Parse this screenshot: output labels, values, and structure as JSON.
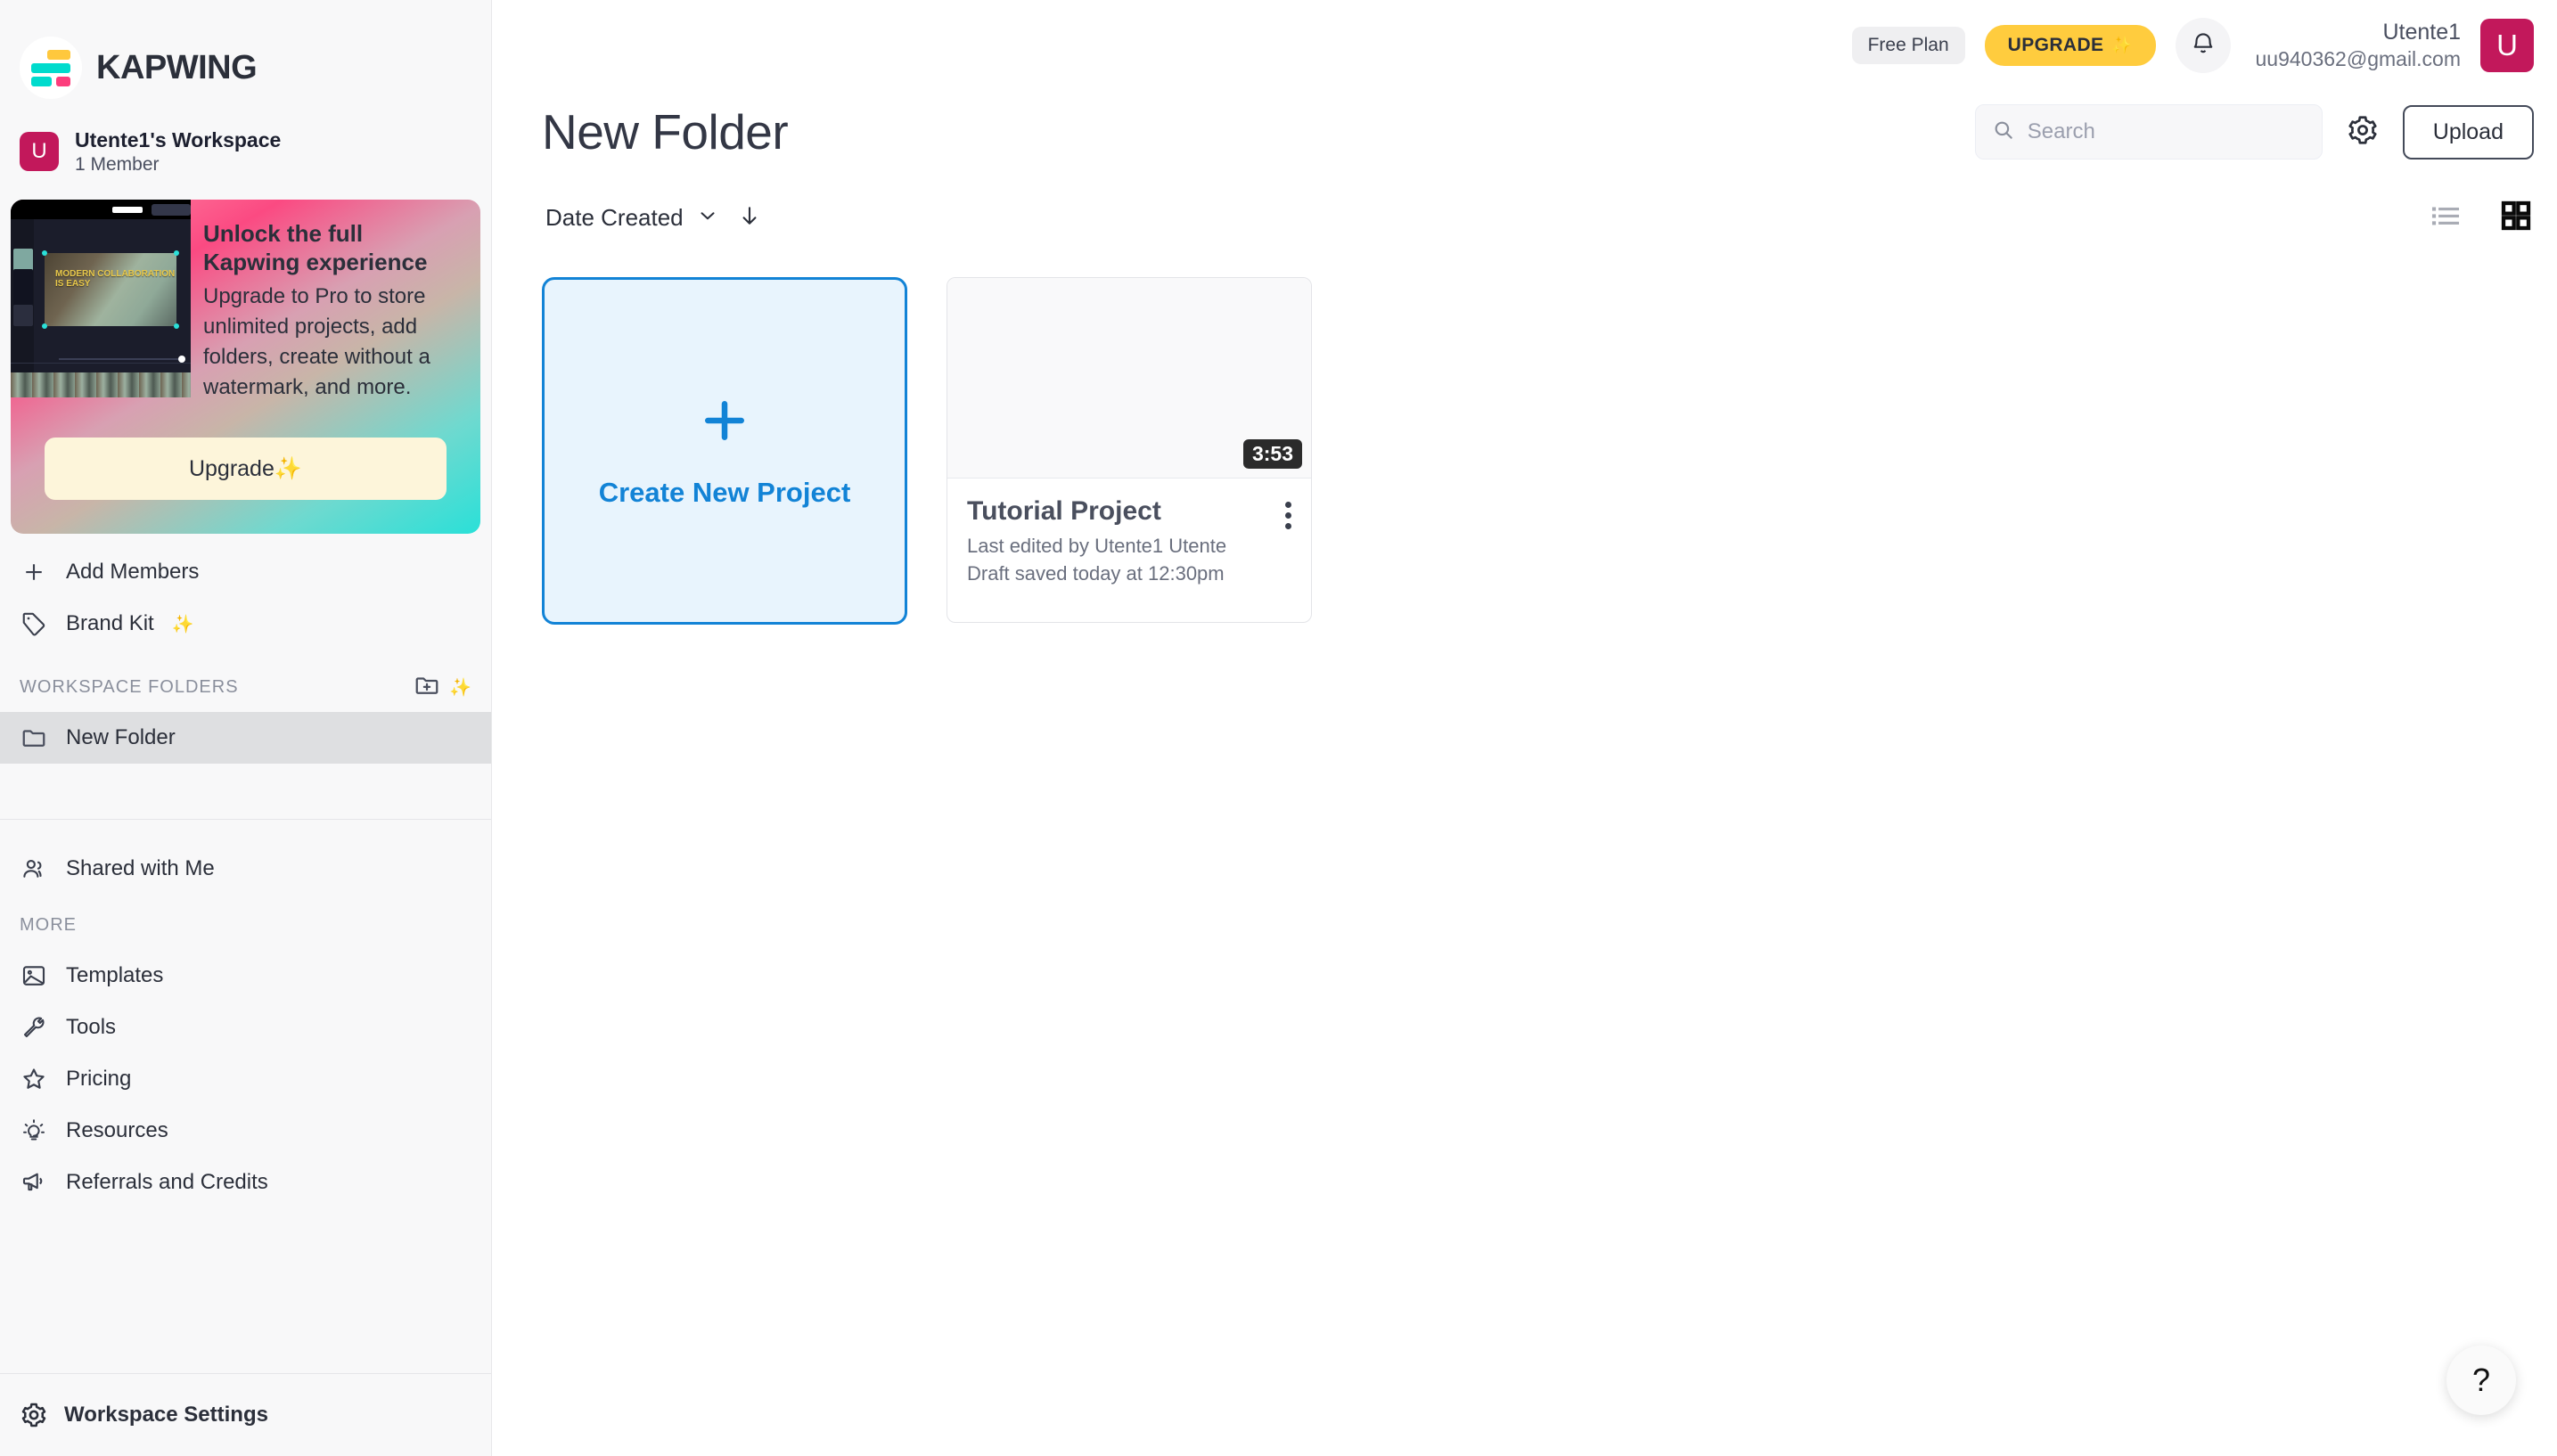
{
  "brand": {
    "name": "KAPWING",
    "logo_icon": "kapwing-logo-icon"
  },
  "workspace": {
    "avatar_letter": "U",
    "title": "Utente1's Workspace",
    "members": "1 Member"
  },
  "promo": {
    "heading": "Unlock the full Kapwing experience",
    "body": "Upgrade to Pro to store unlimited projects, add folders, create without a watermark, and more.",
    "button_label": "Upgrade",
    "button_sparkle": "✨",
    "thumb_text": "MODERN COLLABORATION IS EASY"
  },
  "sidebar": {
    "primary_items": [
      {
        "label": "Add Members",
        "icon": "plus-icon"
      },
      {
        "label": "Brand Kit",
        "icon": "tag-icon",
        "sparkle": "✨"
      }
    ],
    "folders_section": {
      "title": "WORKSPACE FOLDERS",
      "new_folder_icon": "folder-plus-icon",
      "sparkle": "✨",
      "items": [
        {
          "label": "New Folder",
          "icon": "folder-icon",
          "selected": true
        }
      ]
    },
    "shared": {
      "label": "Shared with Me",
      "icon": "users-icon"
    },
    "more_section": {
      "title": "MORE",
      "items": [
        {
          "label": "Templates",
          "icon": "image-icon"
        },
        {
          "label": "Tools",
          "icon": "wrench-icon"
        },
        {
          "label": "Pricing",
          "icon": "star-icon"
        },
        {
          "label": "Resources",
          "icon": "lightbulb-icon"
        },
        {
          "label": "Referrals and Credits",
          "icon": "megaphone-icon"
        }
      ]
    },
    "settings": {
      "label": "Workspace Settings",
      "icon": "gear-icon"
    }
  },
  "topbar": {
    "plan_badge": "Free Plan",
    "upgrade_label": "UPGRADE",
    "upgrade_sparkle": "✨",
    "bell_icon": "bell-icon",
    "user_name": "Utente1",
    "user_email": "uu940362@gmail.com",
    "user_avatar_letter": "U"
  },
  "page": {
    "title": "New Folder",
    "search": {
      "placeholder": "Search",
      "value": "",
      "icon": "search-icon"
    },
    "settings_icon": "gear-icon",
    "upload_label": "Upload"
  },
  "toolbar": {
    "sort_label": "Date Created",
    "sort_chevron_icon": "chevron-down-icon",
    "sort_direction_icon": "arrow-down-icon",
    "list_view_icon": "list-view-icon",
    "grid_view_icon": "grid-view-icon",
    "active_view": "grid"
  },
  "content": {
    "create_card": {
      "label": "Create New Project",
      "icon": "plus-icon"
    },
    "projects": [
      {
        "title": "Tutorial Project",
        "duration": "3:53",
        "meta_line_1": "Last edited by Utente1 Utente",
        "meta_line_2": "Draft saved today at 12:30pm",
        "menu_icon": "kebab-menu-icon"
      }
    ]
  },
  "help": {
    "label": "?",
    "icon": "question-mark-icon"
  },
  "colors": {
    "accent_blue": "#1283d6",
    "brand_pink": "#c2185b",
    "upgrade_yellow": "#ffcc3e",
    "logo_cyan": "#00dbcd",
    "logo_yellow": "#ffc83d",
    "logo_pink": "#fc3d7c",
    "sidebar_bg": "#f8f8f9",
    "selected_bg": "#dedfe1"
  }
}
